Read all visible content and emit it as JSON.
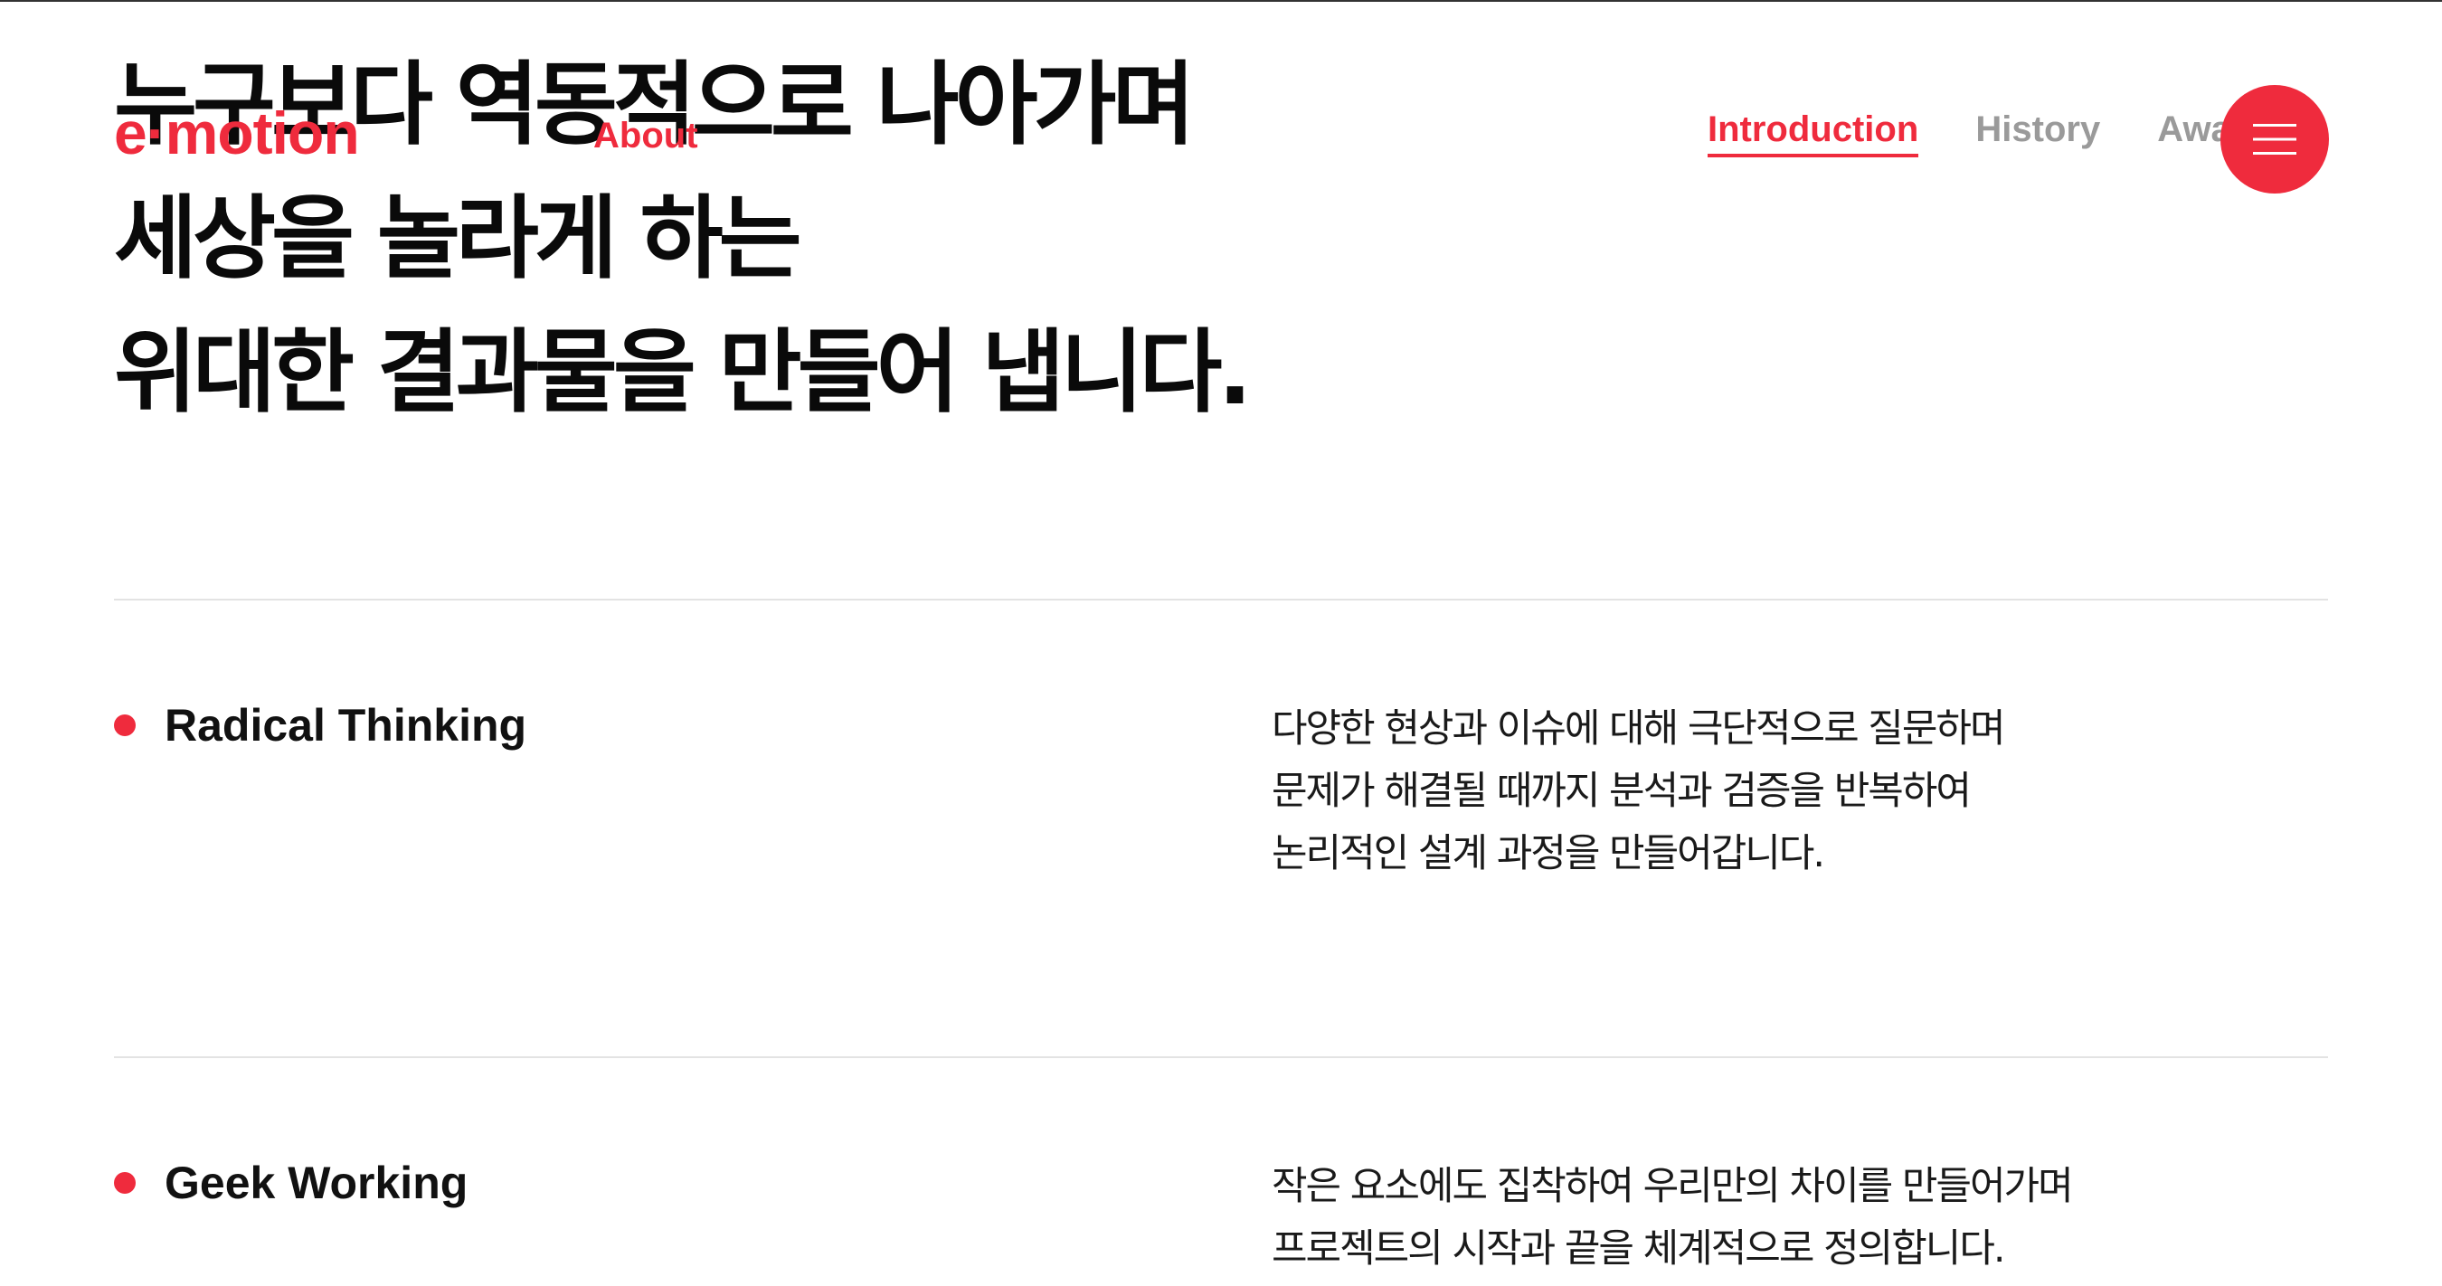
{
  "header": {
    "logo": "e·motion",
    "nav_about": "About",
    "subnav": [
      {
        "label": "Introduction",
        "active": true
      },
      {
        "label": "History",
        "active": false
      },
      {
        "label": "Awards",
        "active": false
      }
    ],
    "menu_icon": "hamburger-icon"
  },
  "hero": {
    "lines": [
      "누구보다 역동적으로 나아가며",
      "세상을 놀라게 하는",
      "위대한 결과물을 만들어 냅니다."
    ]
  },
  "sections": [
    {
      "title": "Radical Thinking",
      "body": [
        "다양한 현상과 이슈에 대해 극단적으로 질문하며",
        "문제가 해결될 때까지 분석과 검증을 반복하여",
        "논리적인 설계 과정을 만들어갑니다."
      ]
    },
    {
      "title": "Geek Working",
      "body": [
        "작은 요소에도 집착하여 우리만의 차이를 만들어가며",
        "프로젝트의 시작과 끝을 체계적으로 정의합니다."
      ]
    }
  ],
  "colors": {
    "accent": "#ef2b3d",
    "text": "#111111",
    "muted": "#9a9a9a",
    "divider": "#e3e3e3"
  }
}
